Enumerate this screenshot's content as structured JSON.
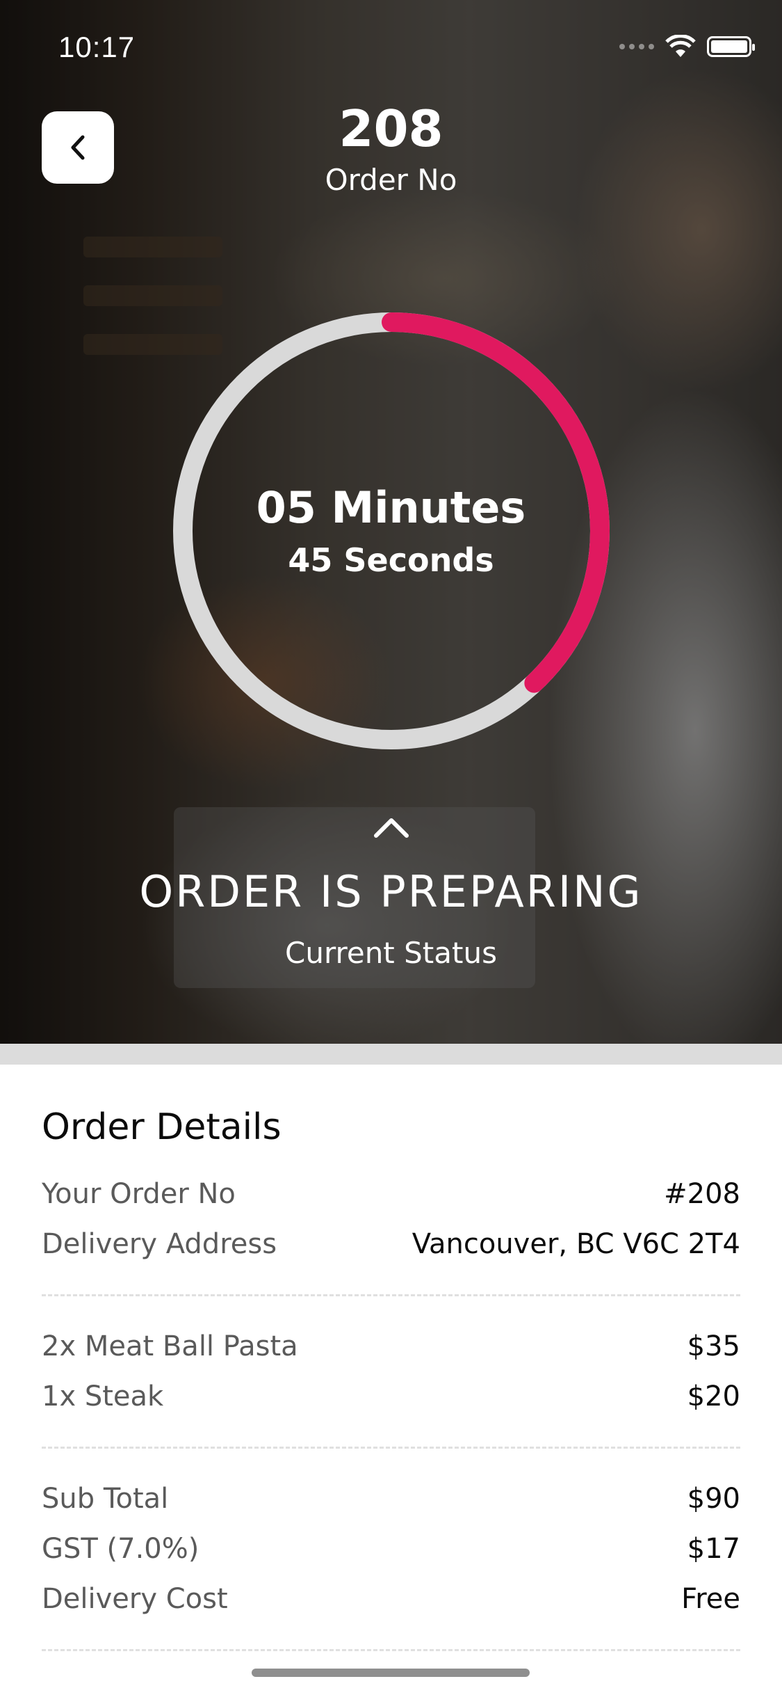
{
  "status_bar": {
    "time": "10:17"
  },
  "header": {
    "order_number": "208",
    "order_label": "Order No"
  },
  "timer": {
    "minutes": "05 Minutes",
    "seconds": "45 Seconds",
    "progress_fraction": 0.38,
    "progress_color": "#e0195f",
    "track_color": "#d9d9d9"
  },
  "status": {
    "title": "ORDER IS PREPARING",
    "subtitle": "Current Status"
  },
  "details": {
    "title": "Order Details",
    "info": [
      {
        "label": "Your Order No",
        "value": "#208"
      },
      {
        "label": "Delivery Address",
        "value": "Vancouver, BC V6C 2T4"
      }
    ],
    "items": [
      {
        "label": "2x Meat Ball Pasta",
        "value": "$35"
      },
      {
        "label": "1x Steak",
        "value": "$20"
      }
    ],
    "totals": [
      {
        "label": "Sub Total",
        "value": "$90"
      },
      {
        "label": "GST (7.0%)",
        "value": "$17"
      },
      {
        "label": "Delivery Cost",
        "value": "Free"
      }
    ]
  }
}
